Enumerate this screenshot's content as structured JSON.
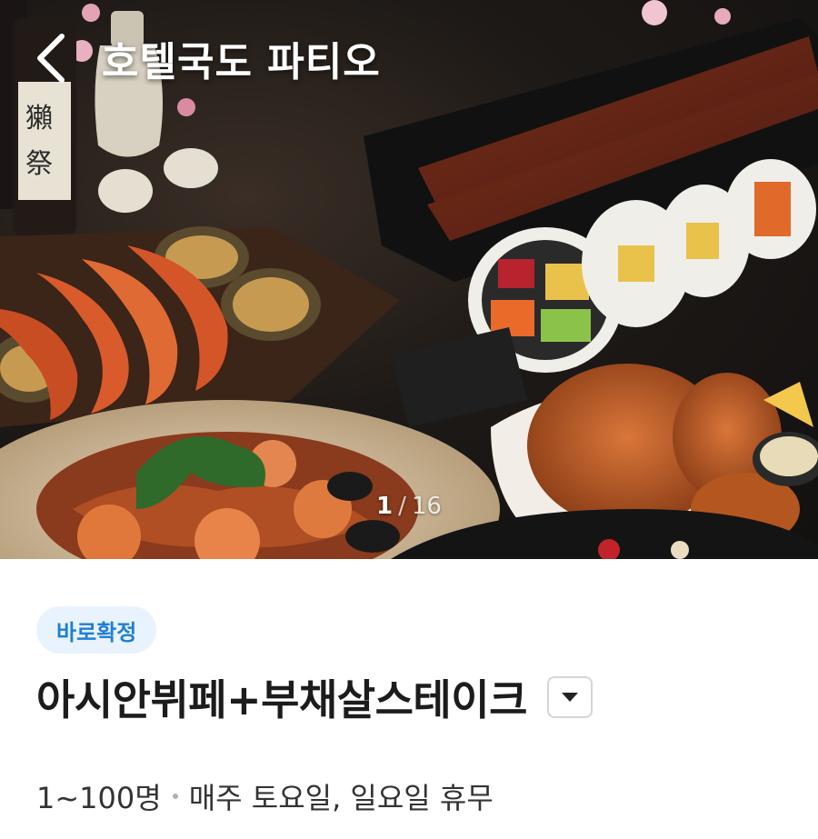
{
  "header": {
    "back_icon": "chevron-left-icon",
    "hotel_name": "호텔국도 파티오"
  },
  "gallery": {
    "current": "1",
    "separator": "/",
    "total": "16"
  },
  "product": {
    "badge": "바로확정",
    "title": "아시안뷔페+부채살스테이크",
    "dropdown_icon": "caret-down-icon",
    "capacity": "1~100명",
    "closed_days": "매주 토요일, 일요일 휴무"
  },
  "colors": {
    "badge_bg": "#e9f3fd",
    "badge_text": "#1f7fd6",
    "title_text": "#1c1c1c"
  }
}
